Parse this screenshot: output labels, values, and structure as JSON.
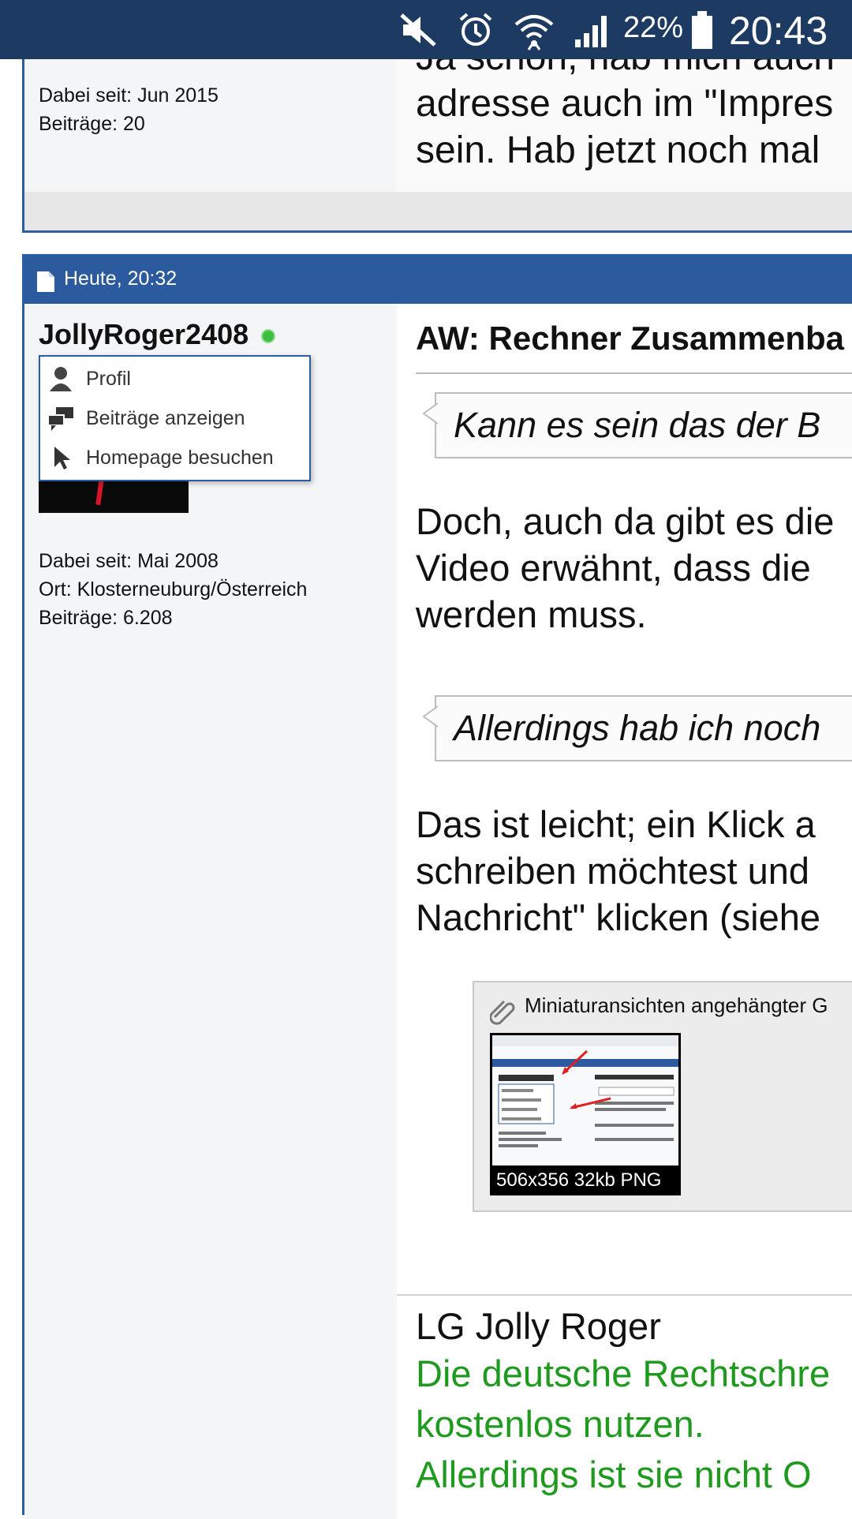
{
  "status_bar": {
    "battery_percent": "22%",
    "time": "20:43",
    "icons": [
      "mute-icon",
      "alarm-icon",
      "wifi-icon",
      "signal-icon",
      "battery-icon"
    ]
  },
  "previous_post": {
    "meta": [
      {
        "label": "Dabei seit:",
        "value": "Jun 2015"
      },
      {
        "label": "Beiträge:",
        "value": "20"
      }
    ],
    "text_lines": [
      "Ja schon, hab mich auch",
      "adresse auch im \"Impres",
      "sein. Hab jetzt noch mal"
    ]
  },
  "post": {
    "date": "Heute, 20:32",
    "username": "JollyRoger2408",
    "user_menu": [
      {
        "label": "Profil",
        "icon": "person-icon"
      },
      {
        "label": "Beiträge anzeigen",
        "icon": "chat-bubbles-icon"
      },
      {
        "label": "Homepage besuchen",
        "icon": "cursor-icon"
      }
    ],
    "info": [
      {
        "label": "Dabei seit:",
        "value": "Mai 2008"
      },
      {
        "label": "Ort:",
        "value": "Klosterneuburg/Österreich"
      },
      {
        "label": "Beiträge:",
        "value": "6.208"
      }
    ],
    "title": "AW: Rechner Zusammenba",
    "quote1": "Kann es sein das der B",
    "paragraph1": [
      "Doch, auch da gibt es die",
      "Video erwähnt, dass die",
      "werden muss."
    ],
    "quote2": "Allerdings hab ich noch",
    "paragraph2": [
      "Das ist leicht; ein Klick a",
      "schreiben möchtest und",
      "Nachricht\" klicken (siehe"
    ],
    "attachment": {
      "title": "Miniaturansichten angehängter G",
      "thumbnail_caption": "506x356 32kb PNG"
    },
    "signature": {
      "name": "LG Jolly Roger",
      "green_lines": [
        "Die deutsche Rechtschre",
        "kostenlos nutzen.",
        "Allerdings ist sie nicht O"
      ]
    }
  },
  "colors": {
    "status_bar": "#1d3a63",
    "post_header": "#2b5a9f",
    "border_blue": "#2a5da5",
    "online_green": "#3fbd3f",
    "signature_green": "#1f9a1f"
  }
}
